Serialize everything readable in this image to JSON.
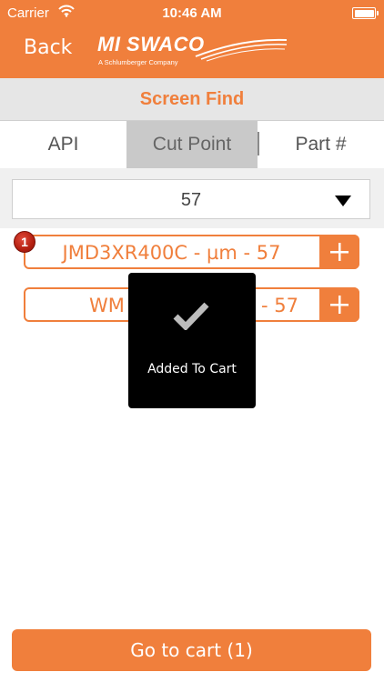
{
  "status_bar": {
    "carrier": "Carrier",
    "time": "10:46 AM"
  },
  "nav": {
    "back_label": "Back",
    "logo_text": "MI SWACO",
    "logo_subtitle": "A Schlumberger Company"
  },
  "title": "Screen Find",
  "tabs": [
    {
      "label": "API",
      "selected": false
    },
    {
      "label": "Cut Point",
      "selected": true
    },
    {
      "label": "Part #",
      "selected": false
    }
  ],
  "filter": {
    "selected_value": "57"
  },
  "results": [
    {
      "label": "JMD3XR400C - µm - 57",
      "badge_count": "1"
    },
    {
      "label_left": "WM",
      "label_right": "- 57"
    }
  ],
  "toast": {
    "icon": "checkmark-icon",
    "message": "Added To Cart"
  },
  "cart_button": {
    "label": "Go to cart (1)"
  },
  "colors": {
    "accent": "#F07F3C",
    "title_bar_bg": "#E6E6E6",
    "selected_tab_bg": "#C9C9C9",
    "toast_bg": "#000000",
    "badge": "#C0281A"
  }
}
